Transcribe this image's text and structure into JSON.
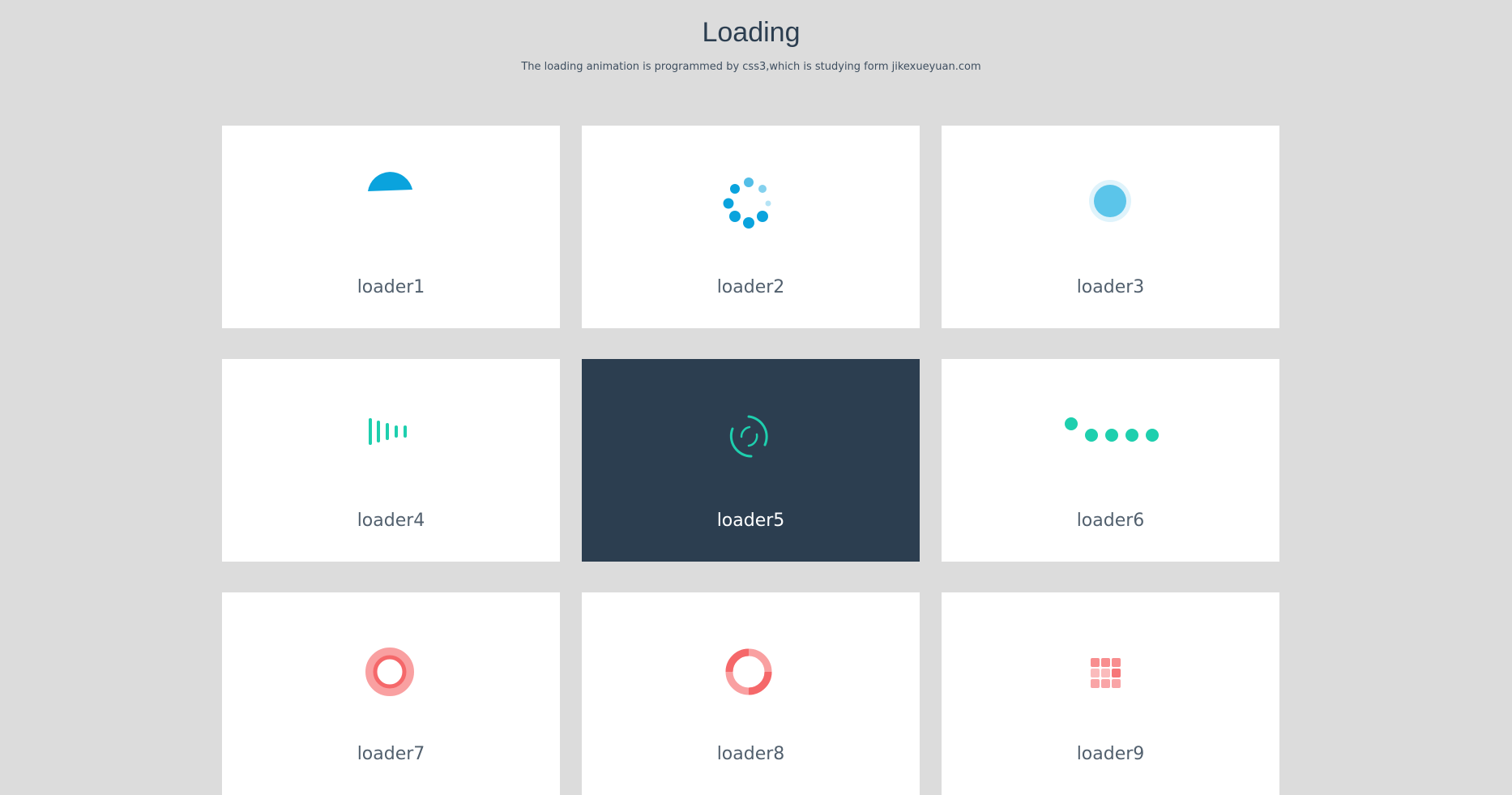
{
  "header": {
    "title": "Loading",
    "subtitle": "The loading animation is programmed by css3,which is studying form jikexueyuan.com"
  },
  "loaders": [
    {
      "label": "loader1",
      "icon": "half-circle-spinner-icon",
      "color": "#0aa3dd"
    },
    {
      "label": "loader2",
      "icon": "dots-ring-spinner-icon",
      "color": "#0aa3dd"
    },
    {
      "label": "loader3",
      "icon": "pulse-circle-icon",
      "color": "#5bc5ea"
    },
    {
      "label": "loader4",
      "icon": "bars-icon",
      "color": "#1ecfae"
    },
    {
      "label": "loader5",
      "icon": "arc-rings-spinner-icon",
      "color": "#1ecfae"
    },
    {
      "label": "loader6",
      "icon": "bouncing-dots-icon",
      "color": "#1ecfae"
    },
    {
      "label": "loader7",
      "icon": "ring-icon",
      "color": "#f5686a"
    },
    {
      "label": "loader8",
      "icon": "segmented-ring-icon",
      "color": "#f5686a"
    },
    {
      "label": "loader9",
      "icon": "grid-squares-icon",
      "color": "#f5686a"
    }
  ],
  "colors": {
    "background": "#dcdcdc",
    "card": "#ffffff",
    "card_active": "#2c3e50",
    "blue": "#0aa3dd",
    "teal": "#1ecfae",
    "coral": "#f5686a"
  }
}
